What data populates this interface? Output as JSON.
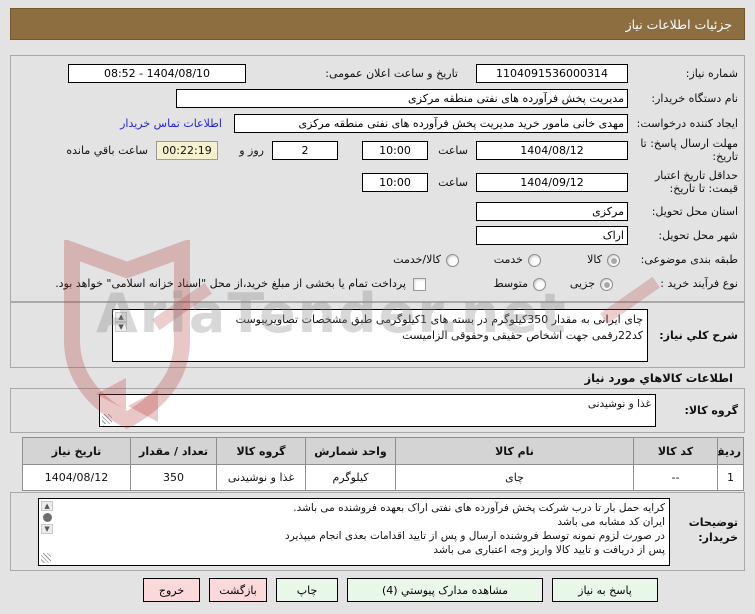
{
  "title_bar": {
    "title": "جزئیات اطلاعات نیاز"
  },
  "watermark": {
    "text": "AriaTender.net"
  },
  "colors": {
    "titlebar_brown": "#8d6e41",
    "page_gray": "#e3e3e3",
    "button_green_bg": "#e9f7e9",
    "button_pink_bg": "#fbd9da",
    "countdown_yellow_bg": "#f5f0cd",
    "link_blue": "#2626cc",
    "watermark_red": "#b23a3a"
  },
  "fields": {
    "need_number": {
      "label": "شماره نیاز:",
      "value": "1104091536000314"
    },
    "announce_datetime": {
      "label": "تاریخ و ساعت اعلان عمومی:",
      "value": "1404/08/10 - 08:52"
    },
    "buyer_org": {
      "label": "نام دستگاه خریدار:",
      "value": "مدیریت پخش فرآورده های نفتی منطقه مرکزی"
    },
    "request_creator": {
      "label": "ایجاد کننده درخواست:",
      "value": "مهدی خانی مامور خرید مدیریت پخش فرآورده های نفتی منطقه مرکزی",
      "contact_link": "اطلاعات تماس خریدار"
    },
    "response_deadline": {
      "label": "مهلت ارسال پاسخ: تا تاریخ:",
      "date": "1404/08/12",
      "hour_label": "ساعت",
      "time": "10:00",
      "days_left": "2",
      "days_sep": "روز و",
      "countdown": "00:22:19",
      "remaining_label": "ساعت باقي مانده"
    },
    "price_validity": {
      "label": "حداقل تاریخ اعتبار قیمت: تا تاریخ:",
      "date": "1404/09/12",
      "hour_label": "ساعت",
      "time": "10:00"
    },
    "province": {
      "label": "استان محل تحویل:",
      "value": "مرکزی"
    },
    "city": {
      "label": "شهر محل تحویل:",
      "value": "اراک"
    },
    "subject_class": {
      "label": "طبقه بندی موضوعی:",
      "options": [
        {
          "label": "کالا",
          "selected": true
        },
        {
          "label": "خدمت",
          "selected": false
        },
        {
          "label": "کالا/خدمت",
          "selected": false
        }
      ]
    },
    "process_type": {
      "label": "نوع فرآیند خرید :",
      "options": [
        {
          "label": "جزیی",
          "selected": true
        },
        {
          "label": "متوسط",
          "selected": false
        }
      ],
      "treasury_checkbox_label": "پرداخت تمام یا بخشی از مبلغ خرید،از محل \"اسناد خزانه اسلامی\" خواهد بود."
    }
  },
  "description": {
    "label": "شرح کلي نیاز:",
    "text": "چای ایرانی به مقدار 350کیلوگرم در بسته های 1کیلوگرمی طبق مشخصات تصاویرپیوست\nکد22رقمی  جهت اشخاص حقیقی وحقوقی الزامیست"
  },
  "goods_section": {
    "header": "اطلاعات کالاهاي مورد نیاز",
    "group_label": "گروه کالا:",
    "group_value": "غذا و نوشیدنی"
  },
  "table": {
    "headers": [
      "ردیف",
      "کد کالا",
      "نام کالا",
      "واحد شمارش",
      "گروه کالا",
      "تعداد / مقدار",
      "تاریخ نیاز"
    ],
    "rows": [
      [
        "1",
        "--",
        "چای",
        "کیلوگرم",
        "غذا و نوشیدنی",
        "350",
        "1404/08/12"
      ]
    ]
  },
  "buyer_notes": {
    "label": "توضیحات خریدار:",
    "text": "کرایه حمل بار تا درب شرکت  پخش فرآورده های نفتی اراک بعهده فروشنده می باشد.\nایران کد مشابه می باشد\nدر صورت لزوم نمونه توسط فروشنده ارسال و پس از تایید اقدامات بعدی انجام میپذیرد\nپس از دریافت و تایید کالا واریز وجه اعتباری می باشد"
  },
  "buttons": [
    {
      "label": "پاسخ به نیاز",
      "type": "green"
    },
    {
      "label": "مشاهده مدارک پیوستي (4)",
      "type": "green"
    },
    {
      "label": "چاپ",
      "type": "green"
    },
    {
      "label": "بازگشت",
      "type": "pink"
    },
    {
      "label": "خروج",
      "type": "pink"
    }
  ]
}
